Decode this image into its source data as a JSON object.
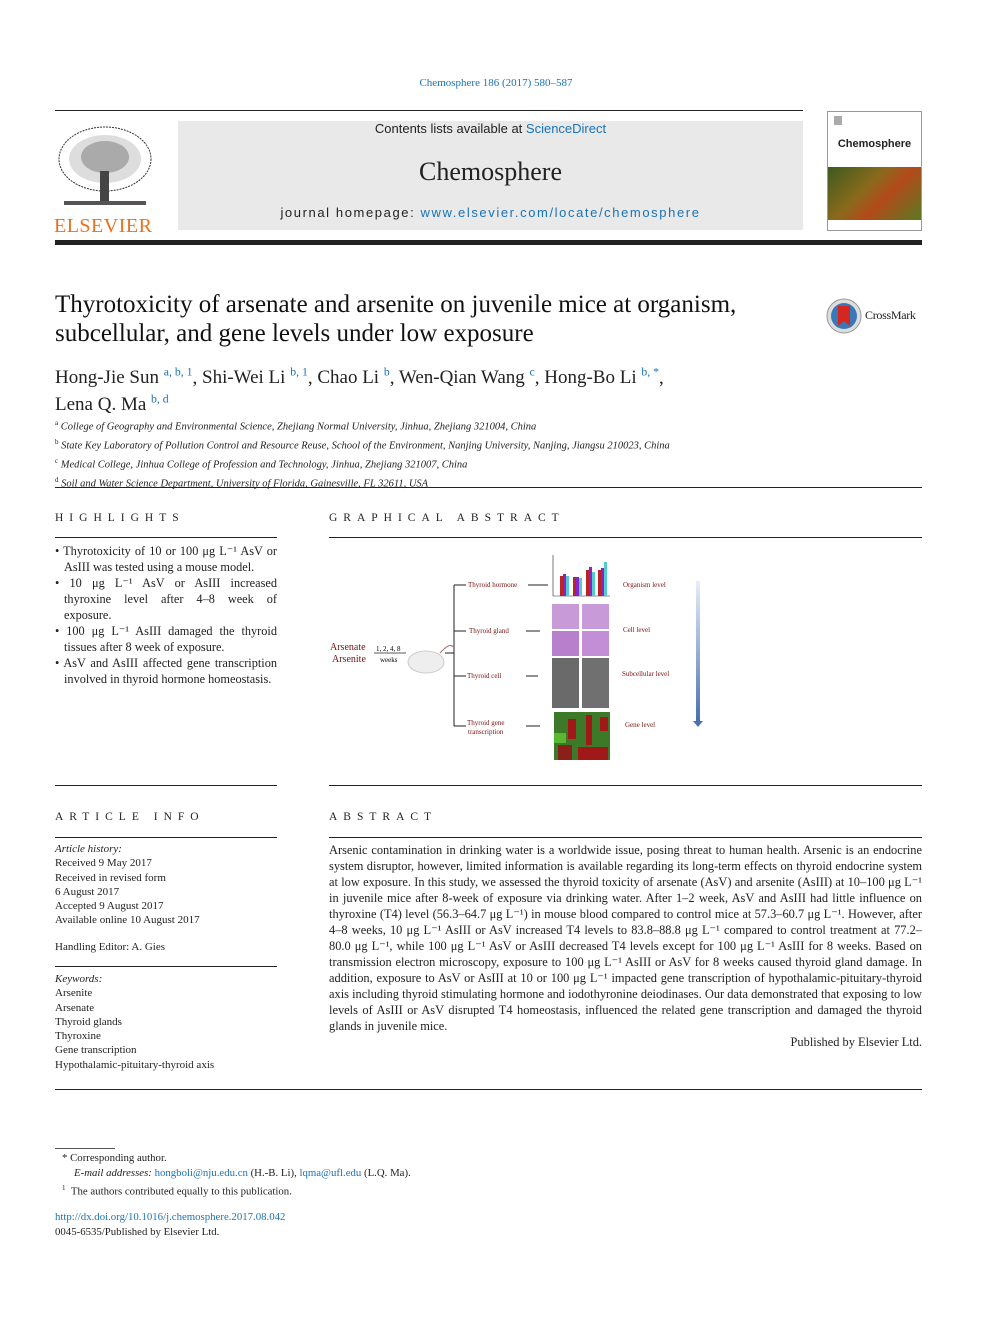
{
  "journal_ref": "Chemosphere 186 (2017) 580–587",
  "header": {
    "contents_prefix": "Contents lists available at ",
    "contents_link": "ScienceDirect",
    "journal_title": "Chemosphere",
    "homepage_prefix": "journal homepage: ",
    "homepage_link": "www.elsevier.com/locate/chemosphere",
    "publisher_logo": "ELSEVIER",
    "cover_title": "Chemosphere"
  },
  "crossmark": "CrossMark",
  "title": "Thyrotoxicity of arsenate and arsenite on juvenile mice at organism, subcellular, and gene levels under low exposure",
  "authors": [
    {
      "name": "Hong-Jie Sun",
      "sup": "a, b, 1"
    },
    {
      "name": "Shi-Wei Li",
      "sup": "b, 1"
    },
    {
      "name": "Chao Li",
      "sup": "b"
    },
    {
      "name": "Wen-Qian Wang",
      "sup": "c"
    },
    {
      "name": "Hong-Bo Li",
      "sup": "b, *"
    },
    {
      "name": "Lena Q. Ma",
      "sup": "b, d"
    }
  ],
  "affiliations": [
    {
      "key": "a",
      "text": "College of Geography and Environmental Science, Zhejiang Normal University, Jinhua, Zhejiang 321004, China"
    },
    {
      "key": "b",
      "text": "State Key Laboratory of Pollution Control and Resource Reuse, School of the Environment, Nanjing University, Nanjing, Jiangsu 210023, China"
    },
    {
      "key": "c",
      "text": "Medical College, Jinhua College of Profession and Technology, Jinhua, Zhejiang 321007, China"
    },
    {
      "key": "d",
      "text": "Soil and Water Science Department, University of Florida, Gainesville, FL 32611, USA"
    }
  ],
  "highlights": {
    "heading": "HIGHLIGHTS",
    "items": [
      "Thyrotoxicity of 10 or 100 μg L⁻¹ AsV or AsIII was tested using a mouse model.",
      "10 μg L⁻¹ AsV or AsIII increased thyroxine level after 4–8 week of exposure.",
      "100 μg L⁻¹ AsIII damaged the thyroid tissues after 8 week of exposure.",
      "AsV and AsIII affected gene transcription involved in thyroid hormone homeostasis."
    ]
  },
  "graphical_abstract": {
    "heading": "GRAPHICAL ABSTRACT",
    "arsenate": "Arsenate",
    "arsenite": "Arsenite",
    "weeks_top": "1, 2, 4, 8",
    "weeks_bottom": "weeks",
    "branches": [
      "Thyroid hormone",
      "Thyroid gland",
      "Thyroid cell",
      "Thyroid gene",
      "transcription"
    ],
    "levels": [
      "Organism level",
      "Cell level",
      "Subcellular level",
      "Gene level"
    ]
  },
  "article_info": {
    "heading": "ARTICLE INFO",
    "history_label": "Article history:",
    "history": [
      "Received 9 May 2017",
      "Received in revised form",
      "6 August 2017",
      "Accepted 9 August 2017",
      "Available online 10 August 2017"
    ],
    "editor": "Handling Editor: A. Gies",
    "keywords_label": "Keywords:",
    "keywords": [
      "Arsenite",
      "Arsenate",
      "Thyroid glands",
      "Thyroxine",
      "Gene transcription",
      "Hypothalamic-pituitary-thyroid axis"
    ]
  },
  "abstract": {
    "heading": "ABSTRACT",
    "text": "Arsenic contamination in drinking water is a worldwide issue, posing threat to human health. Arsenic is an endocrine system disruptor, however, limited information is available regarding its long-term effects on thyroid endocrine system at low exposure. In this study, we assessed the thyroid toxicity of arsenate (AsV) and arsenite (AsIII) at 10–100 μg L⁻¹ in juvenile mice after 8-week of exposure via drinking water. After 1–2 week, AsV and AsIII had little influence on thyroxine (T4) level (56.3–64.7 μg L⁻¹) in mouse blood compared to control mice at 57.3–60.7 μg L⁻¹. However, after 4–8 weeks, 10 μg L⁻¹ AsIII or AsV increased T4 levels to 83.8–88.8 μg L⁻¹ compared to control treatment at 77.2–80.0 μg L⁻¹, while 100 μg L⁻¹ AsV or AsIII decreased T4 levels except for 100 μg L⁻¹ AsIII for 8 weeks. Based on transmission electron microscopy, exposure to 100 μg L⁻¹ AsIII or AsV for 8 weeks caused thyroid gland damage. In addition, exposure to AsV or AsIII at 10 or 100 μg L⁻¹ impacted gene transcription of hypothalamic-pituitary-thyroid axis including thyroid stimulating hormone and iodothyronine deiodinases. Our data demonstrated that exposing to low levels of AsIII or AsV disrupted T4 homeostasis, influenced the related gene transcription and damaged the thyroid glands in juvenile mice.",
    "publisher": "Published by Elsevier Ltd."
  },
  "footnotes": {
    "corresponding": "* Corresponding author.",
    "email_label": "E-mail addresses: ",
    "email1": "hongboli@nju.edu.cn",
    "email1_who": " (H.-B. Li), ",
    "email2": "lqma@ufl.edu",
    "email2_who": " (L.Q. Ma).",
    "equal": "The authors contributed equally to this publication.",
    "equal_mark": "1",
    "doi": "http://dx.doi.org/10.1016/j.chemosphere.2017.08.042",
    "issn": "0045-6535/Published by Elsevier Ltd."
  },
  "colors": {
    "link": "#1a73b8",
    "elsevier_orange": "#e9711c",
    "label_red": "#7a1010"
  }
}
